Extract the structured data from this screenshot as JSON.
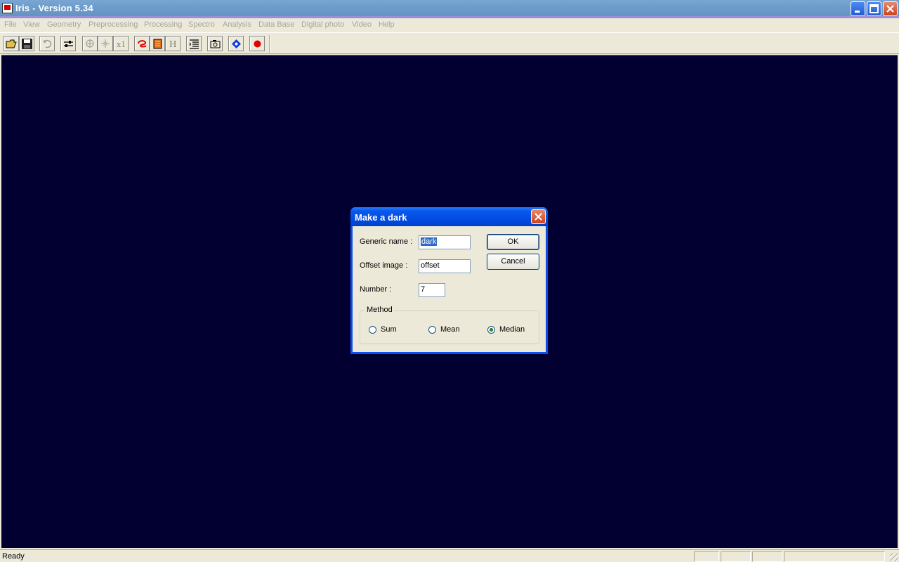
{
  "window": {
    "title": "Iris - Version 5.34"
  },
  "menu": [
    "File",
    "View",
    "Geometry",
    "Preprocessing",
    "Processing",
    "Spectro",
    "Analysis",
    "Data Base",
    "Digital photo",
    "Video",
    "Help"
  ],
  "toolbar": {
    "tools": [
      "open-folder-icon",
      "save-icon",
      "undo-icon",
      "adjust-icon",
      "zoom-in-icon",
      "zoom-out-icon",
      "zoom-1x-icon",
      "spiral-icon",
      "palette-icon",
      "histogram-icon",
      "list-icon",
      "camera-icon",
      "star-dots-icon",
      "record-icon"
    ],
    "zoom_label": "x1",
    "histogram_label": "H"
  },
  "status": {
    "text": "Ready"
  },
  "dialog": {
    "title": "Make a dark",
    "generic_name_label": "Generic name :",
    "generic_name_value": "dark",
    "offset_label": "Offset image :",
    "offset_value": "offset",
    "number_label": "Number :",
    "number_value": "7",
    "ok_label": "OK",
    "cancel_label": "Cancel",
    "method_label": "Method",
    "methods": [
      "Sum",
      "Mean",
      "Median"
    ],
    "selected_method": "Median"
  },
  "colors": {
    "canvas": "#010030",
    "dialog_border": "#0a4ef2",
    "title_bar": "#6d9ccb"
  }
}
